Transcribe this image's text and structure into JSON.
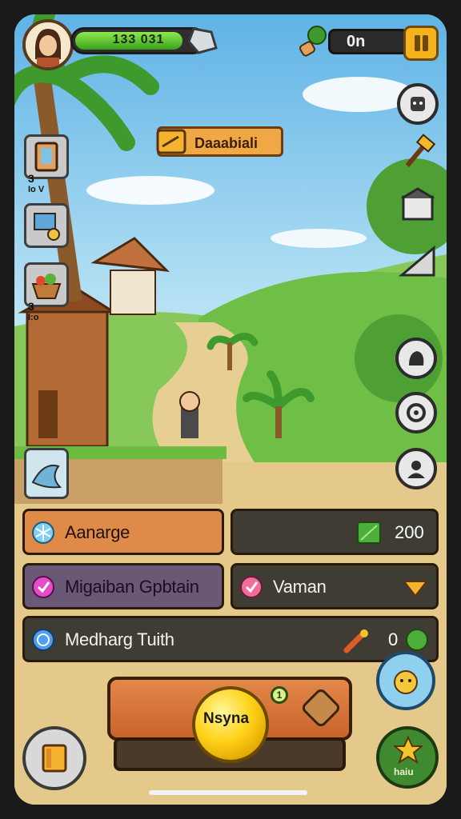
{
  "hud": {
    "xp_text": "133 031",
    "xp_fraction": 0.85,
    "resource_value": "0n",
    "pause_icon": "pause-icon",
    "avatar_icon": "player-avatar"
  },
  "quest_banner": {
    "label": "Daaabiali",
    "icon": "quest-scroll-icon"
  },
  "left_slots": [
    {
      "icon": "map-scroll-icon",
      "count": "3",
      "sub": "Io  V"
    },
    {
      "icon": "crafting-tools-icon",
      "count": "",
      "sub": ""
    },
    {
      "icon": "food-basket-icon",
      "count": "3",
      "sub": "I:o"
    },
    {
      "icon": "fish-item-icon",
      "count": "",
      "sub": ""
    }
  ],
  "right_buttons": [
    {
      "icon": "robot-icon"
    },
    {
      "icon": "hammer-icon"
    },
    {
      "icon": "building-icon"
    },
    {
      "icon": "graph-icon"
    },
    {
      "icon": "animal-icon"
    },
    {
      "icon": "target-icon"
    },
    {
      "icon": "profile-icon"
    }
  ],
  "panels": {
    "row1_left": {
      "label": "Aanarge",
      "icon": "snowflake-icon"
    },
    "row1_right": {
      "value": "200",
      "icon": "green-gem-icon"
    },
    "row2_left": {
      "label": "Migaiban Gpbtain",
      "icon": "pink-orb-icon"
    },
    "row2_right": {
      "label": "Vaman",
      "icon": "heart-icon",
      "extra_icon": "chevron-down-icon"
    },
    "row3": {
      "label": "Medharg Tuith",
      "value": "0",
      "icon": "blue-orb-icon"
    }
  },
  "action": {
    "orb_label": "Nsyna",
    "badge": "1",
    "side_icon": "crate-icon",
    "right_badge_label": "haiu",
    "right_top_icon": "dog-face-icon",
    "left_bottom_icon": "book-icon"
  },
  "colors": {
    "sky": "#7fc6ea",
    "grass": "#7cbf4e",
    "panel_orange": "#e08a4a",
    "panel_dark": "#3f3c34",
    "panel_purple": "#6a5876",
    "gold": "#ffd21a"
  }
}
